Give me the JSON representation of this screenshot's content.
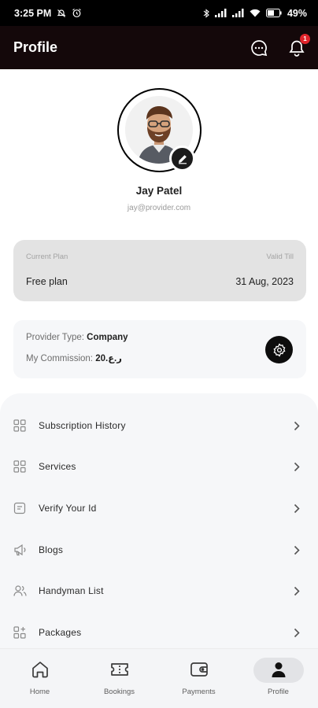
{
  "status_bar": {
    "time": "3:25 PM",
    "battery": "49%"
  },
  "app_bar": {
    "title": "Profile",
    "notification_count": "1",
    "chat_icon": "chat-bubble-icon",
    "bell_icon": "bell-icon"
  },
  "profile": {
    "name": "Jay Patel",
    "email": "jay@provider.com",
    "edit_icon": "pencil-icon"
  },
  "plan": {
    "current_plan_caption": "Current Plan",
    "current_plan_value": "Free plan",
    "valid_till_caption": "Valid Till",
    "valid_till_value": "31 Aug, 2023"
  },
  "provider": {
    "type_label": "Provider Type:",
    "type_value": "Company",
    "commission_label": "My Commission:",
    "commission_value": "20.ر.ع",
    "settings_icon": "gear-icon"
  },
  "menu": {
    "items": [
      {
        "label": "Subscription History",
        "icon": "grid-icon"
      },
      {
        "label": "Services",
        "icon": "grid-icon"
      },
      {
        "label": "Verify Your Id",
        "icon": "id-card-icon"
      },
      {
        "label": "Blogs",
        "icon": "megaphone-icon"
      },
      {
        "label": "Handyman List",
        "icon": "users-icon"
      },
      {
        "label": "Packages",
        "icon": "grid-plus-icon"
      }
    ]
  },
  "bottom_nav": {
    "items": [
      {
        "label": "Home",
        "icon": "home-icon"
      },
      {
        "label": "Bookings",
        "icon": "ticket-icon"
      },
      {
        "label": "Payments",
        "icon": "wallet-icon"
      },
      {
        "label": "Profile",
        "icon": "person-icon"
      }
    ],
    "active": "Profile"
  },
  "colors": {
    "app_bar_bg": "#14080a",
    "accent_dark": "#0d0d0d",
    "badge": "#e0242b",
    "panel_bg": "#f6f7f9",
    "plan_card_bg": "#e3e3e3"
  }
}
